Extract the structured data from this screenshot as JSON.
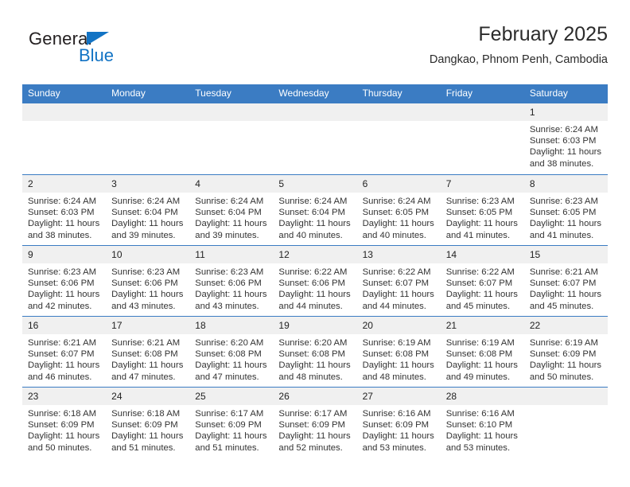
{
  "brand": {
    "name_part1": "General",
    "name_part2": "Blue"
  },
  "header": {
    "title": "February 2025",
    "location": "Dangkao, Phnom Penh, Cambodia"
  },
  "colors": {
    "header_blue": "#3b7cc3",
    "brand_blue": "#1273c4",
    "daynumber_bg": "#f0f0f0"
  },
  "weekdays": [
    "Sunday",
    "Monday",
    "Tuesday",
    "Wednesday",
    "Thursday",
    "Friday",
    "Saturday"
  ],
  "labels": {
    "sunrise": "Sunrise:",
    "sunset": "Sunset:",
    "daylight": "Daylight:"
  },
  "weeks": [
    [
      {
        "day": "",
        "empty": true
      },
      {
        "day": "",
        "empty": true
      },
      {
        "day": "",
        "empty": true
      },
      {
        "day": "",
        "empty": true
      },
      {
        "day": "",
        "empty": true
      },
      {
        "day": "",
        "empty": true
      },
      {
        "day": "1",
        "sunrise": "Sunrise: 6:24 AM",
        "sunset": "Sunset: 6:03 PM",
        "daylight_line1": "Daylight: 11 hours",
        "daylight_line2": "and 38 minutes."
      }
    ],
    [
      {
        "day": "2",
        "sunrise": "Sunrise: 6:24 AM",
        "sunset": "Sunset: 6:03 PM",
        "daylight_line1": "Daylight: 11 hours",
        "daylight_line2": "and 38 minutes."
      },
      {
        "day": "3",
        "sunrise": "Sunrise: 6:24 AM",
        "sunset": "Sunset: 6:04 PM",
        "daylight_line1": "Daylight: 11 hours",
        "daylight_line2": "and 39 minutes."
      },
      {
        "day": "4",
        "sunrise": "Sunrise: 6:24 AM",
        "sunset": "Sunset: 6:04 PM",
        "daylight_line1": "Daylight: 11 hours",
        "daylight_line2": "and 39 minutes."
      },
      {
        "day": "5",
        "sunrise": "Sunrise: 6:24 AM",
        "sunset": "Sunset: 6:04 PM",
        "daylight_line1": "Daylight: 11 hours",
        "daylight_line2": "and 40 minutes."
      },
      {
        "day": "6",
        "sunrise": "Sunrise: 6:24 AM",
        "sunset": "Sunset: 6:05 PM",
        "daylight_line1": "Daylight: 11 hours",
        "daylight_line2": "and 40 minutes."
      },
      {
        "day": "7",
        "sunrise": "Sunrise: 6:23 AM",
        "sunset": "Sunset: 6:05 PM",
        "daylight_line1": "Daylight: 11 hours",
        "daylight_line2": "and 41 minutes."
      },
      {
        "day": "8",
        "sunrise": "Sunrise: 6:23 AM",
        "sunset": "Sunset: 6:05 PM",
        "daylight_line1": "Daylight: 11 hours",
        "daylight_line2": "and 41 minutes."
      }
    ],
    [
      {
        "day": "9",
        "sunrise": "Sunrise: 6:23 AM",
        "sunset": "Sunset: 6:06 PM",
        "daylight_line1": "Daylight: 11 hours",
        "daylight_line2": "and 42 minutes."
      },
      {
        "day": "10",
        "sunrise": "Sunrise: 6:23 AM",
        "sunset": "Sunset: 6:06 PM",
        "daylight_line1": "Daylight: 11 hours",
        "daylight_line2": "and 43 minutes."
      },
      {
        "day": "11",
        "sunrise": "Sunrise: 6:23 AM",
        "sunset": "Sunset: 6:06 PM",
        "daylight_line1": "Daylight: 11 hours",
        "daylight_line2": "and 43 minutes."
      },
      {
        "day": "12",
        "sunrise": "Sunrise: 6:22 AM",
        "sunset": "Sunset: 6:06 PM",
        "daylight_line1": "Daylight: 11 hours",
        "daylight_line2": "and 44 minutes."
      },
      {
        "day": "13",
        "sunrise": "Sunrise: 6:22 AM",
        "sunset": "Sunset: 6:07 PM",
        "daylight_line1": "Daylight: 11 hours",
        "daylight_line2": "and 44 minutes."
      },
      {
        "day": "14",
        "sunrise": "Sunrise: 6:22 AM",
        "sunset": "Sunset: 6:07 PM",
        "daylight_line1": "Daylight: 11 hours",
        "daylight_line2": "and 45 minutes."
      },
      {
        "day": "15",
        "sunrise": "Sunrise: 6:21 AM",
        "sunset": "Sunset: 6:07 PM",
        "daylight_line1": "Daylight: 11 hours",
        "daylight_line2": "and 45 minutes."
      }
    ],
    [
      {
        "day": "16",
        "sunrise": "Sunrise: 6:21 AM",
        "sunset": "Sunset: 6:07 PM",
        "daylight_line1": "Daylight: 11 hours",
        "daylight_line2": "and 46 minutes."
      },
      {
        "day": "17",
        "sunrise": "Sunrise: 6:21 AM",
        "sunset": "Sunset: 6:08 PM",
        "daylight_line1": "Daylight: 11 hours",
        "daylight_line2": "and 47 minutes."
      },
      {
        "day": "18",
        "sunrise": "Sunrise: 6:20 AM",
        "sunset": "Sunset: 6:08 PM",
        "daylight_line1": "Daylight: 11 hours",
        "daylight_line2": "and 47 minutes."
      },
      {
        "day": "19",
        "sunrise": "Sunrise: 6:20 AM",
        "sunset": "Sunset: 6:08 PM",
        "daylight_line1": "Daylight: 11 hours",
        "daylight_line2": "and 48 minutes."
      },
      {
        "day": "20",
        "sunrise": "Sunrise: 6:19 AM",
        "sunset": "Sunset: 6:08 PM",
        "daylight_line1": "Daylight: 11 hours",
        "daylight_line2": "and 48 minutes."
      },
      {
        "day": "21",
        "sunrise": "Sunrise: 6:19 AM",
        "sunset": "Sunset: 6:08 PM",
        "daylight_line1": "Daylight: 11 hours",
        "daylight_line2": "and 49 minutes."
      },
      {
        "day": "22",
        "sunrise": "Sunrise: 6:19 AM",
        "sunset": "Sunset: 6:09 PM",
        "daylight_line1": "Daylight: 11 hours",
        "daylight_line2": "and 50 minutes."
      }
    ],
    [
      {
        "day": "23",
        "sunrise": "Sunrise: 6:18 AM",
        "sunset": "Sunset: 6:09 PM",
        "daylight_line1": "Daylight: 11 hours",
        "daylight_line2": "and 50 minutes."
      },
      {
        "day": "24",
        "sunrise": "Sunrise: 6:18 AM",
        "sunset": "Sunset: 6:09 PM",
        "daylight_line1": "Daylight: 11 hours",
        "daylight_line2": "and 51 minutes."
      },
      {
        "day": "25",
        "sunrise": "Sunrise: 6:17 AM",
        "sunset": "Sunset: 6:09 PM",
        "daylight_line1": "Daylight: 11 hours",
        "daylight_line2": "and 51 minutes."
      },
      {
        "day": "26",
        "sunrise": "Sunrise: 6:17 AM",
        "sunset": "Sunset: 6:09 PM",
        "daylight_line1": "Daylight: 11 hours",
        "daylight_line2": "and 52 minutes."
      },
      {
        "day": "27",
        "sunrise": "Sunrise: 6:16 AM",
        "sunset": "Sunset: 6:09 PM",
        "daylight_line1": "Daylight: 11 hours",
        "daylight_line2": "and 53 minutes."
      },
      {
        "day": "28",
        "sunrise": "Sunrise: 6:16 AM",
        "sunset": "Sunset: 6:10 PM",
        "daylight_line1": "Daylight: 11 hours",
        "daylight_line2": "and 53 minutes."
      },
      {
        "day": "",
        "empty": true
      }
    ]
  ]
}
